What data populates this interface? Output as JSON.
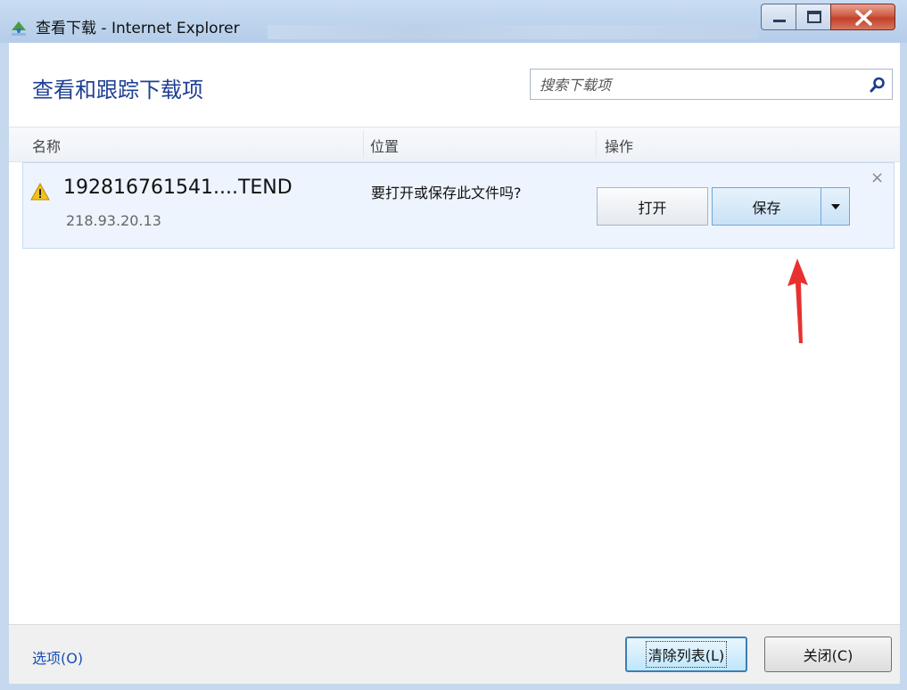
{
  "window": {
    "title": "查看下载 - Internet Explorer"
  },
  "header": {
    "heading": "查看和跟踪下载项",
    "search_placeholder": "搜索下载项"
  },
  "columns": {
    "name": "名称",
    "location": "位置",
    "actions": "操作"
  },
  "download": {
    "file_name": "192816761541....TEND",
    "host": "218.93.20.13",
    "prompt": "要打开或保存此文件吗?",
    "open_label": "打开",
    "save_label": "保存",
    "dismiss": "×"
  },
  "footer": {
    "options_label": "选项(O)",
    "clear_label": "清除列表(L)",
    "close_label": "关闭(C)"
  },
  "colors": {
    "heading": "#1e3f94",
    "row_bg": "#edf4fd",
    "arrow": "#e8312f",
    "link": "#1a4fb4"
  }
}
